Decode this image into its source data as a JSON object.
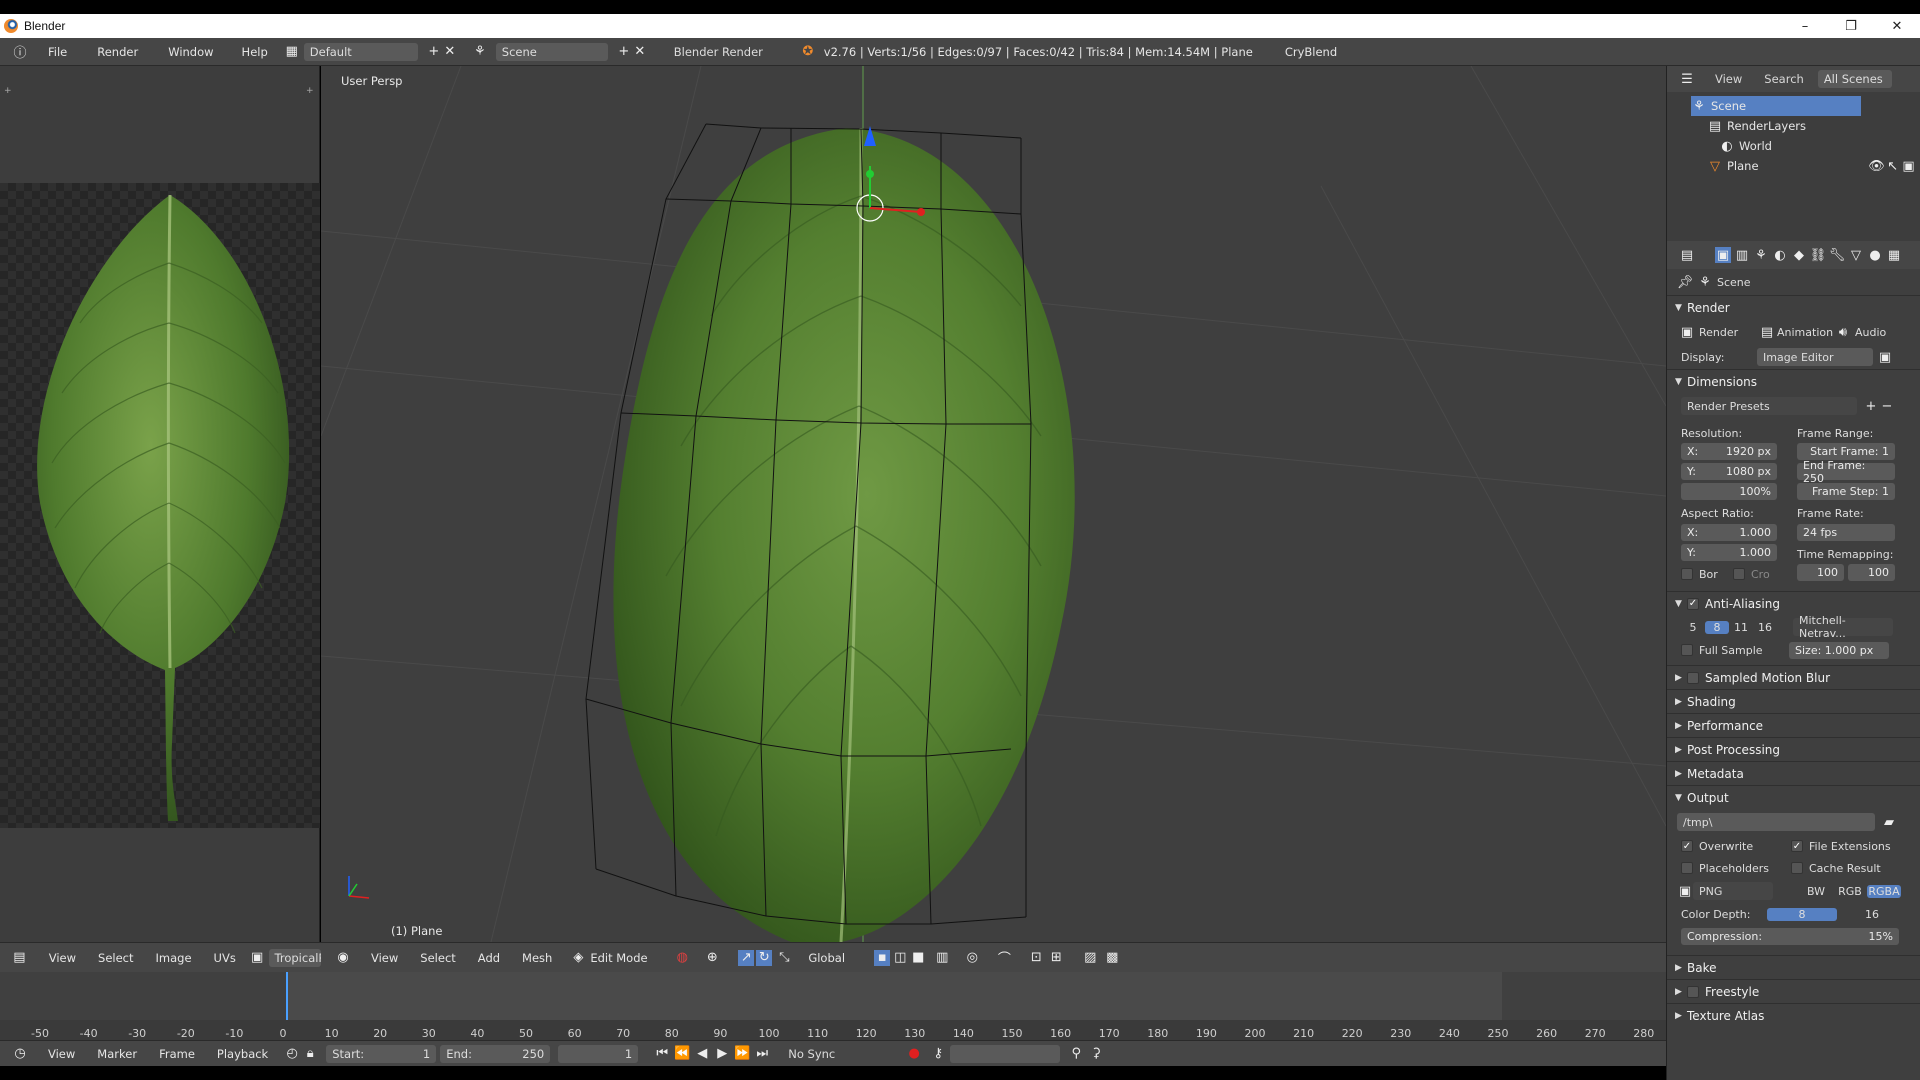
{
  "window": {
    "title": "Blender",
    "controls": [
      "–",
      "❐",
      "✕"
    ]
  },
  "infobar": {
    "menus": [
      "File",
      "Render",
      "Window",
      "Help"
    ],
    "layout": "Default",
    "scene": "Scene",
    "engine": "Blender Render",
    "stats": "v2.76 | Verts:1/56 | Edges:0/97 | Faces:0/42 | Tris:84 | Mem:14.54M | Plane",
    "addon": "CryBlend"
  },
  "uv_editor": {
    "header_items": [
      "View",
      "Select",
      "Image",
      "UVs"
    ],
    "image_name": "TropicalPl"
  },
  "viewport": {
    "view_label": "User Persp",
    "object_label": "(1) Plane",
    "header_items": [
      "View",
      "Select",
      "Add",
      "Mesh"
    ],
    "mode": "Edit Mode",
    "orientation": "Global"
  },
  "timeline": {
    "ticks": [
      "-50",
      "-40",
      "-30",
      "-20",
      "-10",
      "0",
      "10",
      "20",
      "30",
      "40",
      "50",
      "60",
      "70",
      "80",
      "90",
      "100",
      "110",
      "120",
      "130",
      "140",
      "150",
      "160",
      "170",
      "180",
      "190",
      "200",
      "210",
      "220",
      "230",
      "240",
      "250",
      "260",
      "270",
      "280"
    ],
    "menus": [
      "View",
      "Marker",
      "Frame",
      "Playback"
    ],
    "start_label": "Start:",
    "start_value": "1",
    "end_label": "End:",
    "end_value": "250",
    "current_frame": "1",
    "sync": "No Sync"
  },
  "outliner": {
    "header": [
      "View",
      "Search",
      "All Scenes"
    ],
    "items": [
      "Scene",
      "RenderLayers",
      "World",
      "Plane"
    ]
  },
  "properties": {
    "context": "Scene",
    "render_panel": "Render",
    "render_buttons": [
      "Render",
      "Animation",
      "Audio"
    ],
    "display_label": "Display:",
    "display_value": "Image Editor",
    "dimensions_panel": "Dimensions",
    "render_presets": "Render Presets",
    "resolution_label": "Resolution:",
    "res_x": "1920 px",
    "res_y": "1080 px",
    "res_pct": "100%",
    "frame_range_label": "Frame Range:",
    "start_frame": "Start Frame: 1",
    "end_frame": "End Frame: 250",
    "frame_step": "Frame Step: 1",
    "aspect_label": "Aspect Ratio:",
    "aspect_x": "1.000",
    "aspect_y": "1.000",
    "frame_rate_label": "Frame Rate:",
    "frame_rate": "24 fps",
    "time_remap_label": "Time Remapping:",
    "remap_old": "100",
    "remap_new": "100",
    "bor": "Bor",
    "cro": "Cro",
    "aa_panel": "Anti-Aliasing",
    "aa_samples": [
      "5",
      "8",
      "11",
      "16"
    ],
    "aa_filter": "Mitchell-Netrav...",
    "full_sample": "Full Sample",
    "aa_size": "Size: 1.000 px",
    "collapsed_panels": [
      "Sampled Motion Blur",
      "Shading",
      "Performance",
      "Post Processing",
      "Metadata"
    ],
    "output_panel": "Output",
    "output_path": "/tmp\\",
    "overwrite": "Overwrite",
    "file_ext": "File Extensions",
    "placeholders": "Placeholders",
    "cache_result": "Cache Result",
    "format": "PNG",
    "color_modes": [
      "BW",
      "RGB",
      "RGBA"
    ],
    "color_depth_label": "Color Depth:",
    "color_depths": [
      "8",
      "16"
    ],
    "compression": "Compression:",
    "compression_value": "15%",
    "bottom_panels": [
      "Bake",
      "Freestyle",
      "Texture Atlas"
    ]
  },
  "colors": {
    "accent": "#5680c2",
    "timeline_cursor": "#4aa0ff",
    "leaf": "#5d8a3a"
  }
}
